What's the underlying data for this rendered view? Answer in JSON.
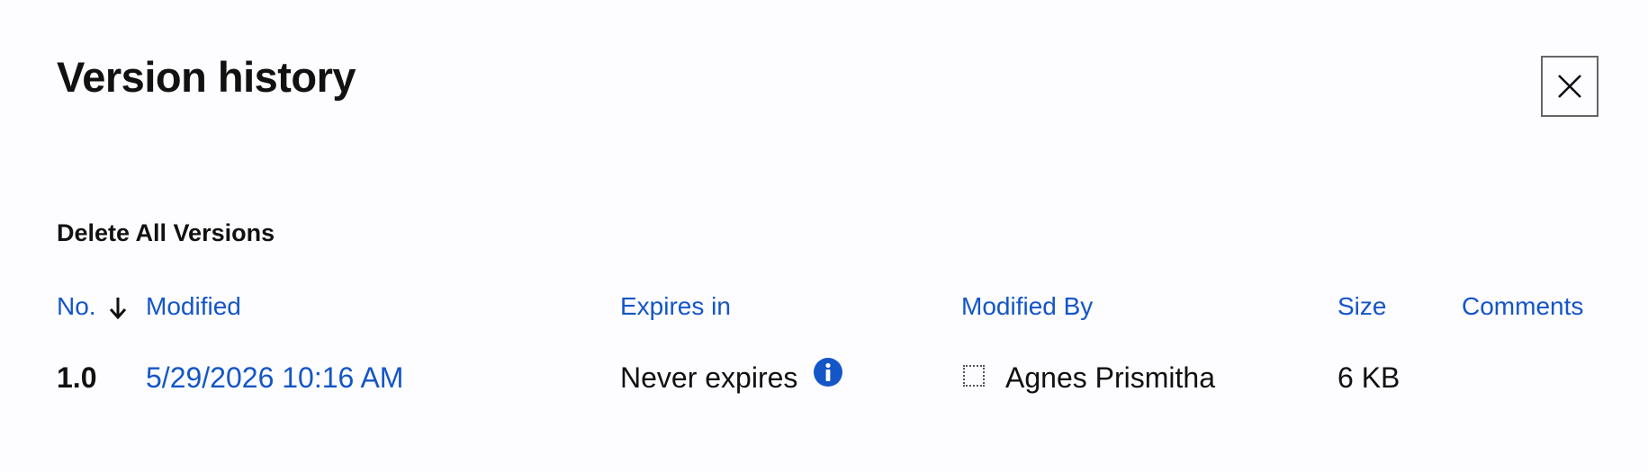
{
  "dialog": {
    "title": "Version history",
    "close_icon": "close-icon"
  },
  "actions": {
    "delete_all_label": "Delete All Versions"
  },
  "table": {
    "columns": [
      {
        "key": "no",
        "label": "No.",
        "sorted": "descending",
        "sort_icon": "arrow-down-icon"
      },
      {
        "key": "modified",
        "label": "Modified"
      },
      {
        "key": "expires",
        "label": "Expires in"
      },
      {
        "key": "modified_by",
        "label": "Modified By"
      },
      {
        "key": "size",
        "label": "Size"
      },
      {
        "key": "comments",
        "label": "Comments"
      }
    ],
    "rows": [
      {
        "no": "1.0",
        "modified": "5/29/2026 10:16 AM",
        "expires": "Never expires",
        "expires_icon": "info-icon",
        "modified_by": "Agnes Prismitha",
        "avatar_icon": "avatar-placeholder-icon",
        "size": "6 KB",
        "comments": ""
      }
    ]
  },
  "colors": {
    "link": "#1456c8",
    "text": "#111111",
    "background": "#fdfcfe",
    "info_icon": "#1456c8"
  }
}
